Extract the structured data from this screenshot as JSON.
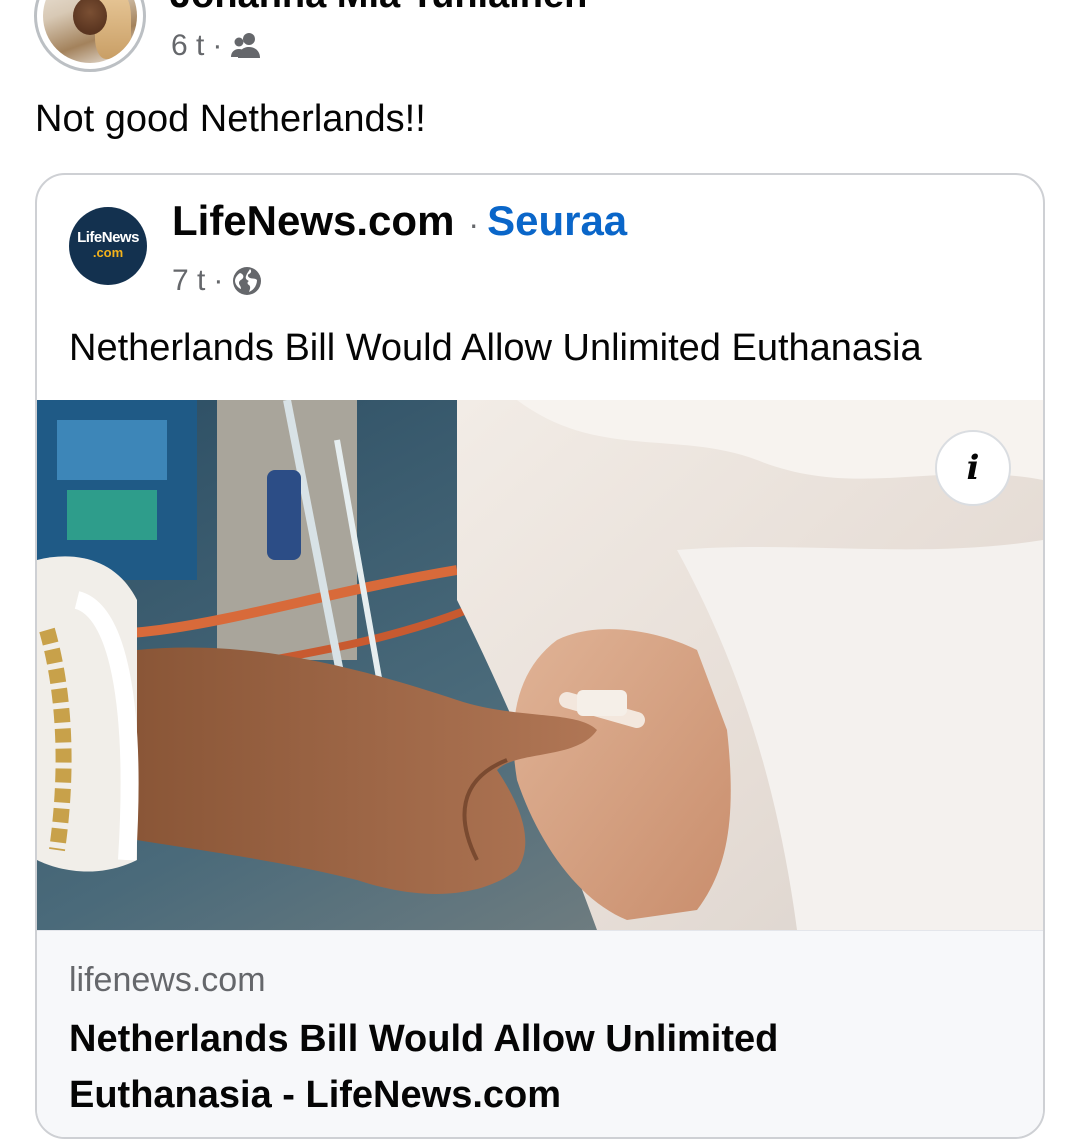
{
  "post": {
    "author_name": "Jonanna Mia Tuhlainen",
    "time": "6 t",
    "separator": "·",
    "audience_icon": "friends-icon",
    "text": "Not good Netherlands!!"
  },
  "shared_card": {
    "page_logo": {
      "top": "LifeNews",
      "bottom": ".com"
    },
    "page_name": "LifeNews.com",
    "separator": "·",
    "follow_label": "Seuraa",
    "time": "7 t",
    "audience_icon": "globe-icon",
    "text": "Netherlands Bill Would Allow Unlimited Euthanasia",
    "link": {
      "image_icon": "info-icon",
      "info_label": "i",
      "domain": "lifenews.com",
      "title": "Netherlands Bill Would Allow Unlimited Euthanasia - LifeNews.com"
    }
  },
  "colors": {
    "text_primary": "#050505",
    "text_secondary": "#65676b",
    "link_blue": "#0a66c9",
    "card_border": "#ced0d4",
    "footer_bg": "#f7f8fa",
    "logo_bg": "#13314f"
  }
}
